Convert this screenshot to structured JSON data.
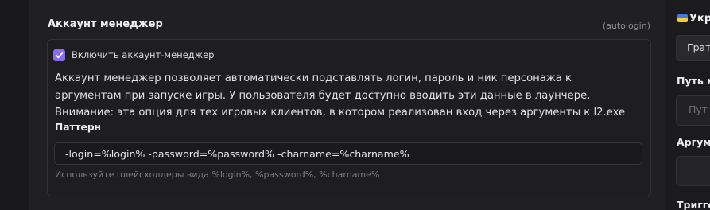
{
  "section": {
    "title": "Аккаунт менеджер",
    "tag": "(autologin)"
  },
  "checkbox": {
    "label": "Включить аккаунт-менеджер",
    "checked": true
  },
  "description": "Аккаунт менеджер позволяет автоматически подставлять логин, пароль и ник персонажа к аргументам при запуске игры. У пользователя будет доступно вводить эти данные в лаунчере. Внимание: эта опция для тех игровых клиентов, в котором реализован вход через аргументы к l2.exe",
  "pattern": {
    "label": "Паттерн",
    "value": "-login=%login% -password=%password% -charname=%charname%",
    "hint": "Используйте плейсхолдеры вида %login%, %password%, %charname%"
  },
  "right_panel": {
    "language_label": "Укр",
    "select_value": "Грат",
    "path_label": "Путь к",
    "path_placeholder": "Пут",
    "args_label": "Аргум",
    "trigger_label": "Тригге",
    "colors": {
      "flag_blue": "#3b7be3",
      "flag_yellow": "#f3cc2f"
    }
  },
  "colors": {
    "accent": "#8a6cf0",
    "background": "#1b1b1d",
    "panel": "#202022"
  }
}
